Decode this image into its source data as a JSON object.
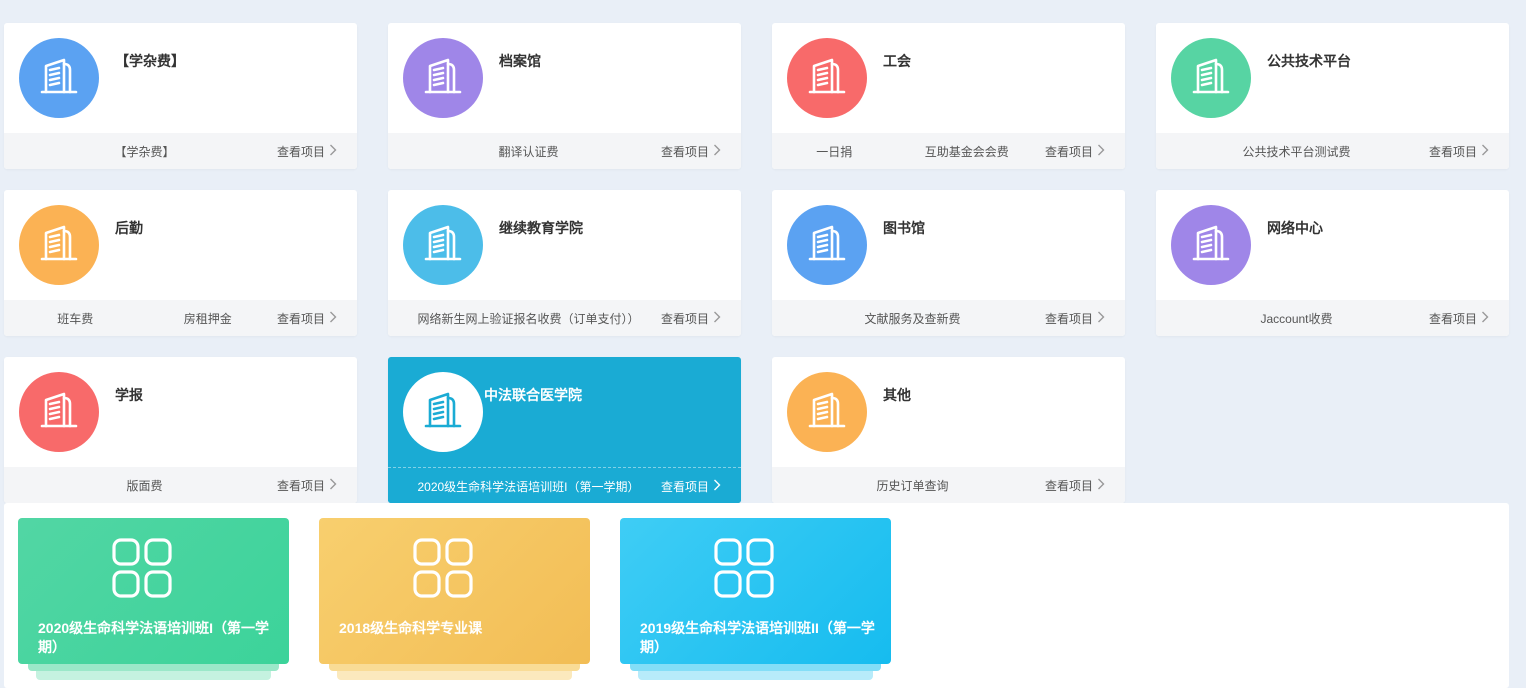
{
  "cards": [
    {
      "title": "【学杂费】",
      "icon": "building-icon",
      "color": "#5ba2f2",
      "items": [
        "【学杂费】"
      ]
    },
    {
      "title": "档案馆",
      "icon": "building-icon",
      "color": "#9f86e8",
      "items": [
        "翻译认证费"
      ]
    },
    {
      "title": "工会",
      "icon": "building-icon",
      "color": "#f86a6a",
      "items": [
        "一日捐",
        "互助基金会会费"
      ]
    },
    {
      "title": "公共技术平台",
      "icon": "building-icon",
      "color": "#57d4a3",
      "items": [
        "公共技术平台测试费"
      ]
    },
    {
      "title": "后勤",
      "icon": "building-icon",
      "color": "#fbb254",
      "items": [
        "班车费",
        "房租押金"
      ]
    },
    {
      "title": "继续教育学院",
      "icon": "building-icon",
      "color": "#4cbde9",
      "items": [
        "网络新生网上验证报名收费（订单支付））"
      ]
    },
    {
      "title": "图书馆",
      "icon": "building-icon",
      "color": "#5ba2f2",
      "items": [
        "文献服务及查新费"
      ]
    },
    {
      "title": "网络中心",
      "icon": "building-icon",
      "color": "#9f86e8",
      "items": [
        "Jaccount收费"
      ]
    },
    {
      "title": "学报",
      "icon": "building-icon",
      "color": "#f86a6a",
      "items": [
        "版面费"
      ]
    },
    {
      "title": "中法联合医学院",
      "icon": "building-icon",
      "color": "#1aabd4",
      "items": [
        "2020级生命科学法语培训班I（第一学期）"
      ],
      "active": true
    },
    {
      "title": "其他",
      "icon": "building-icon",
      "color": "#fbb254",
      "items": [
        "历史订单查询"
      ]
    }
  ],
  "view_label": "查看项目",
  "tiles": [
    {
      "label": "2020级生命科学法语培训班I（第一学期）",
      "icon": "grid-icon",
      "color_from": "#52d6a4",
      "color_to": "#3cd39a",
      "stack1": "#9be8c9",
      "stack2": "#c5f2e0"
    },
    {
      "label": "2018级生命科学专业课",
      "icon": "grid-icon",
      "color_from": "#f8cf6e",
      "color_to": "#f2bd55",
      "stack1": "#f9dc96",
      "stack2": "#fbe9bd"
    },
    {
      "label": "2019级生命科学法语培训班II（第一学期）",
      "icon": "grid-icon",
      "color_from": "#3fcdf5",
      "color_to": "#16bcef",
      "stack1": "#84def7",
      "stack2": "#b7ebfa"
    }
  ]
}
